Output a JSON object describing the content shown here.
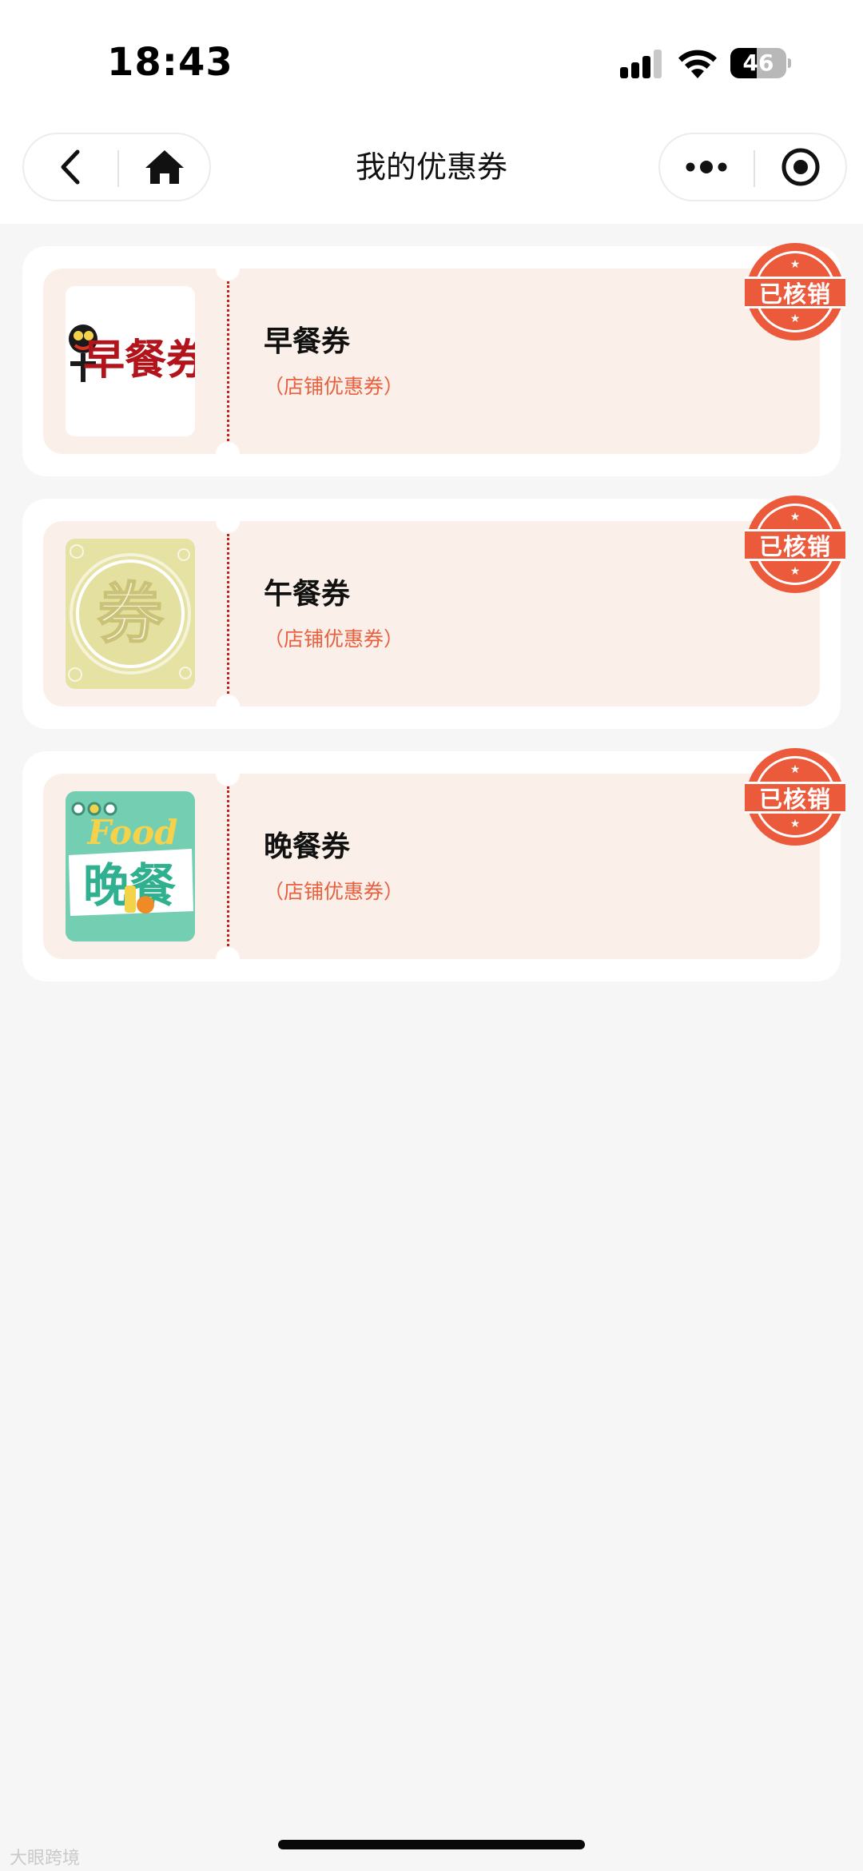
{
  "status_bar": {
    "time": "18:43",
    "battery": "46"
  },
  "nav": {
    "title": "我的优惠券"
  },
  "coupons": [
    {
      "name": "早餐券",
      "type": "（店铺优惠券）",
      "stamp": "已核销",
      "thumb_text": "早餐券"
    },
    {
      "name": "午餐券",
      "type": "（店铺优惠券）",
      "stamp": "已核销",
      "thumb_text": "券"
    },
    {
      "name": "晚餐券",
      "type": "（店铺优惠券）",
      "stamp": "已核销",
      "thumb_text": "晚餐",
      "thumb_sub": "Food"
    }
  ],
  "watermark": "大眼跨境",
  "colors": {
    "accent": "#ec5a3c",
    "coupon_bg": "#fbefe9",
    "coupon_type": "#e9603f",
    "page_bg": "#f6f6f6"
  }
}
